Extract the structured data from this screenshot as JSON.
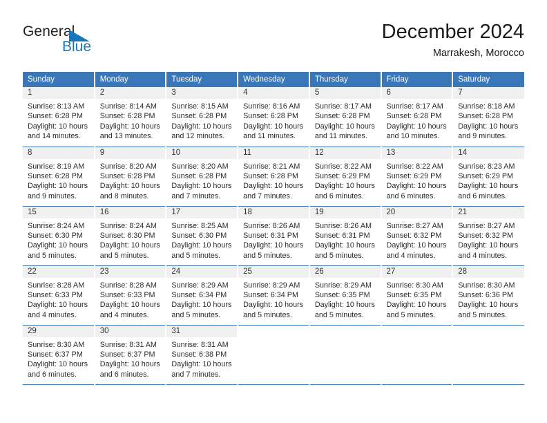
{
  "brand": {
    "name_part1": "General",
    "name_part2": "Blue",
    "triangle_color": "#1b75bb"
  },
  "header": {
    "month_title": "December 2024",
    "location": "Marrakesh, Morocco"
  },
  "theme": {
    "header_blue": "#3a77b8",
    "daynum_band": "#f0f0f0",
    "text": "#2b2b2b"
  },
  "weekday_headers": [
    "Sunday",
    "Monday",
    "Tuesday",
    "Wednesday",
    "Thursday",
    "Friday",
    "Saturday"
  ],
  "labels": {
    "sunrise_prefix": "Sunrise:",
    "sunset_prefix": "Sunset:",
    "daylight_prefix": "Daylight:"
  },
  "weeks": [
    [
      {
        "day": "1",
        "sunrise": "Sunrise: 8:13 AM",
        "sunset": "Sunset: 6:28 PM",
        "daylight": "Daylight: 10 hours and 14 minutes."
      },
      {
        "day": "2",
        "sunrise": "Sunrise: 8:14 AM",
        "sunset": "Sunset: 6:28 PM",
        "daylight": "Daylight: 10 hours and 13 minutes."
      },
      {
        "day": "3",
        "sunrise": "Sunrise: 8:15 AM",
        "sunset": "Sunset: 6:28 PM",
        "daylight": "Daylight: 10 hours and 12 minutes."
      },
      {
        "day": "4",
        "sunrise": "Sunrise: 8:16 AM",
        "sunset": "Sunset: 6:28 PM",
        "daylight": "Daylight: 10 hours and 11 minutes."
      },
      {
        "day": "5",
        "sunrise": "Sunrise: 8:17 AM",
        "sunset": "Sunset: 6:28 PM",
        "daylight": "Daylight: 10 hours and 11 minutes."
      },
      {
        "day": "6",
        "sunrise": "Sunrise: 8:17 AM",
        "sunset": "Sunset: 6:28 PM",
        "daylight": "Daylight: 10 hours and 10 minutes."
      },
      {
        "day": "7",
        "sunrise": "Sunrise: 8:18 AM",
        "sunset": "Sunset: 6:28 PM",
        "daylight": "Daylight: 10 hours and 9 minutes."
      }
    ],
    [
      {
        "day": "8",
        "sunrise": "Sunrise: 8:19 AM",
        "sunset": "Sunset: 6:28 PM",
        "daylight": "Daylight: 10 hours and 9 minutes."
      },
      {
        "day": "9",
        "sunrise": "Sunrise: 8:20 AM",
        "sunset": "Sunset: 6:28 PM",
        "daylight": "Daylight: 10 hours and 8 minutes."
      },
      {
        "day": "10",
        "sunrise": "Sunrise: 8:20 AM",
        "sunset": "Sunset: 6:28 PM",
        "daylight": "Daylight: 10 hours and 7 minutes."
      },
      {
        "day": "11",
        "sunrise": "Sunrise: 8:21 AM",
        "sunset": "Sunset: 6:28 PM",
        "daylight": "Daylight: 10 hours and 7 minutes."
      },
      {
        "day": "12",
        "sunrise": "Sunrise: 8:22 AM",
        "sunset": "Sunset: 6:29 PM",
        "daylight": "Daylight: 10 hours and 6 minutes."
      },
      {
        "day": "13",
        "sunrise": "Sunrise: 8:22 AM",
        "sunset": "Sunset: 6:29 PM",
        "daylight": "Daylight: 10 hours and 6 minutes."
      },
      {
        "day": "14",
        "sunrise": "Sunrise: 8:23 AM",
        "sunset": "Sunset: 6:29 PM",
        "daylight": "Daylight: 10 hours and 6 minutes."
      }
    ],
    [
      {
        "day": "15",
        "sunrise": "Sunrise: 8:24 AM",
        "sunset": "Sunset: 6:30 PM",
        "daylight": "Daylight: 10 hours and 5 minutes."
      },
      {
        "day": "16",
        "sunrise": "Sunrise: 8:24 AM",
        "sunset": "Sunset: 6:30 PM",
        "daylight": "Daylight: 10 hours and 5 minutes."
      },
      {
        "day": "17",
        "sunrise": "Sunrise: 8:25 AM",
        "sunset": "Sunset: 6:30 PM",
        "daylight": "Daylight: 10 hours and 5 minutes."
      },
      {
        "day": "18",
        "sunrise": "Sunrise: 8:26 AM",
        "sunset": "Sunset: 6:31 PM",
        "daylight": "Daylight: 10 hours and 5 minutes."
      },
      {
        "day": "19",
        "sunrise": "Sunrise: 8:26 AM",
        "sunset": "Sunset: 6:31 PM",
        "daylight": "Daylight: 10 hours and 5 minutes."
      },
      {
        "day": "20",
        "sunrise": "Sunrise: 8:27 AM",
        "sunset": "Sunset: 6:32 PM",
        "daylight": "Daylight: 10 hours and 4 minutes."
      },
      {
        "day": "21",
        "sunrise": "Sunrise: 8:27 AM",
        "sunset": "Sunset: 6:32 PM",
        "daylight": "Daylight: 10 hours and 4 minutes."
      }
    ],
    [
      {
        "day": "22",
        "sunrise": "Sunrise: 8:28 AM",
        "sunset": "Sunset: 6:33 PM",
        "daylight": "Daylight: 10 hours and 4 minutes."
      },
      {
        "day": "23",
        "sunrise": "Sunrise: 8:28 AM",
        "sunset": "Sunset: 6:33 PM",
        "daylight": "Daylight: 10 hours and 4 minutes."
      },
      {
        "day": "24",
        "sunrise": "Sunrise: 8:29 AM",
        "sunset": "Sunset: 6:34 PM",
        "daylight": "Daylight: 10 hours and 5 minutes."
      },
      {
        "day": "25",
        "sunrise": "Sunrise: 8:29 AM",
        "sunset": "Sunset: 6:34 PM",
        "daylight": "Daylight: 10 hours and 5 minutes."
      },
      {
        "day": "26",
        "sunrise": "Sunrise: 8:29 AM",
        "sunset": "Sunset: 6:35 PM",
        "daylight": "Daylight: 10 hours and 5 minutes."
      },
      {
        "day": "27",
        "sunrise": "Sunrise: 8:30 AM",
        "sunset": "Sunset: 6:35 PM",
        "daylight": "Daylight: 10 hours and 5 minutes."
      },
      {
        "day": "28",
        "sunrise": "Sunrise: 8:30 AM",
        "sunset": "Sunset: 6:36 PM",
        "daylight": "Daylight: 10 hours and 5 minutes."
      }
    ],
    [
      {
        "day": "29",
        "sunrise": "Sunrise: 8:30 AM",
        "sunset": "Sunset: 6:37 PM",
        "daylight": "Daylight: 10 hours and 6 minutes."
      },
      {
        "day": "30",
        "sunrise": "Sunrise: 8:31 AM",
        "sunset": "Sunset: 6:37 PM",
        "daylight": "Daylight: 10 hours and 6 minutes."
      },
      {
        "day": "31",
        "sunrise": "Sunrise: 8:31 AM",
        "sunset": "Sunset: 6:38 PM",
        "daylight": "Daylight: 10 hours and 7 minutes."
      },
      {
        "day": "",
        "sunrise": "",
        "sunset": "",
        "daylight": ""
      },
      {
        "day": "",
        "sunrise": "",
        "sunset": "",
        "daylight": ""
      },
      {
        "day": "",
        "sunrise": "",
        "sunset": "",
        "daylight": ""
      },
      {
        "day": "",
        "sunrise": "",
        "sunset": "",
        "daylight": ""
      }
    ]
  ]
}
